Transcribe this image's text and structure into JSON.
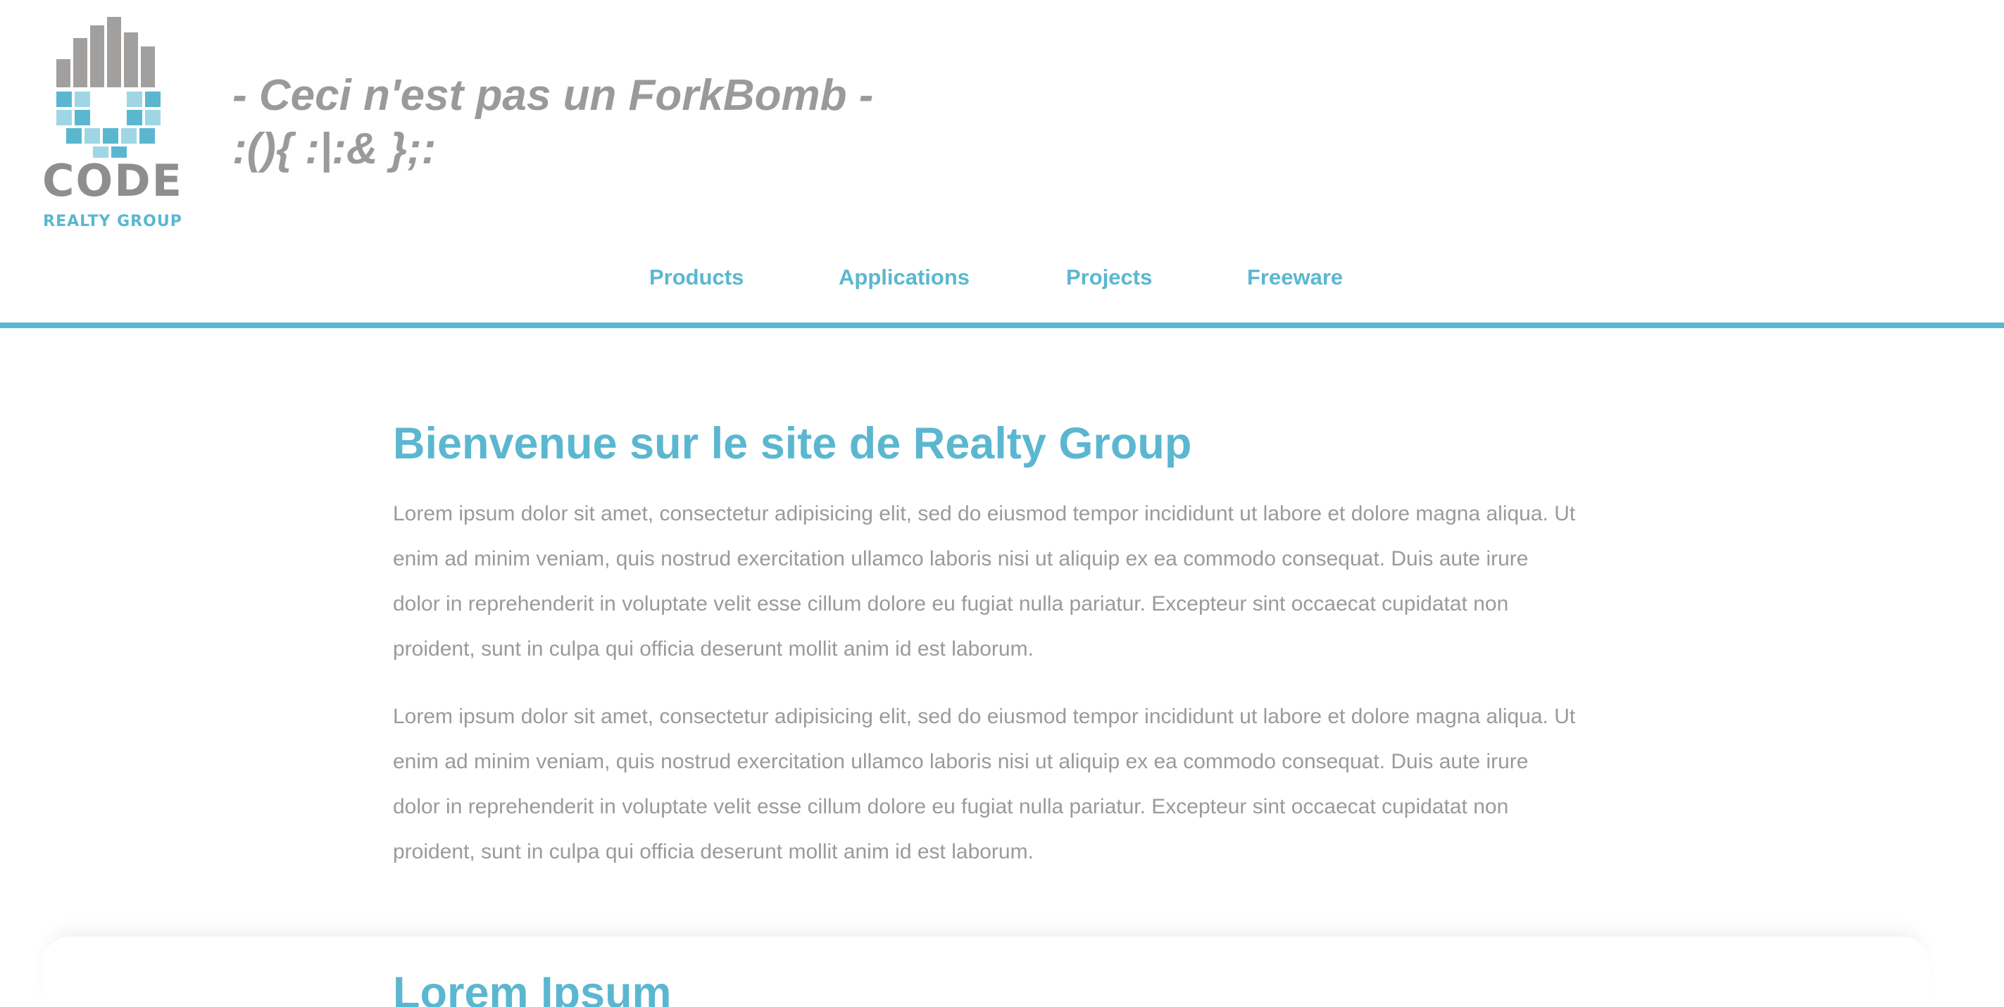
{
  "logo": {
    "word": "CODE",
    "subword": "REALTY GROUP"
  },
  "header": {
    "tagline_line1": "- Ceci n'est pas un ForkBomb -",
    "tagline_line2": ":(){ :|:& };:"
  },
  "nav": {
    "items": [
      {
        "label": "Products"
      },
      {
        "label": "Applications"
      },
      {
        "label": "Projects"
      },
      {
        "label": "Freeware"
      }
    ]
  },
  "main": {
    "title": "Bienvenue sur le site de Realty Group",
    "paragraphs": [
      "Lorem ipsum dolor sit amet, consectetur adipisicing elit, sed do eiusmod tempor incididunt ut labore et dolore magna aliqua. Ut enim ad minim veniam, quis nostrud exercitation ullamco laboris nisi ut aliquip ex ea commodo consequat. Duis aute irure dolor in reprehenderit in voluptate velit esse cillum dolore eu fugiat nulla pariatur. Excepteur sint occaecat cupidatat non proident, sunt in culpa qui officia deserunt mollit anim id est laborum.",
      "Lorem ipsum dolor sit amet, consectetur adipisicing elit, sed do eiusmod tempor incididunt ut labore et dolore magna aliqua. Ut enim ad minim veniam, quis nostrud exercitation ullamco laboris nisi ut aliquip ex ea commodo consequat. Duis aute irure dolor in reprehenderit in voluptate velit esse cillum dolore eu fugiat nulla pariatur. Excepteur sint occaecat cupidatat non proident, sunt in culpa qui officia deserunt mollit anim id est laborum."
    ],
    "section_title": "Lorem Ipsum"
  },
  "colors": {
    "accent": "#5bb7d0",
    "text_gray": "#9a9a9a",
    "logo_gray": "#8f8d8d",
    "logo_blue": "#5bb7d0",
    "logo_light_blue": "#9fd6e6"
  }
}
